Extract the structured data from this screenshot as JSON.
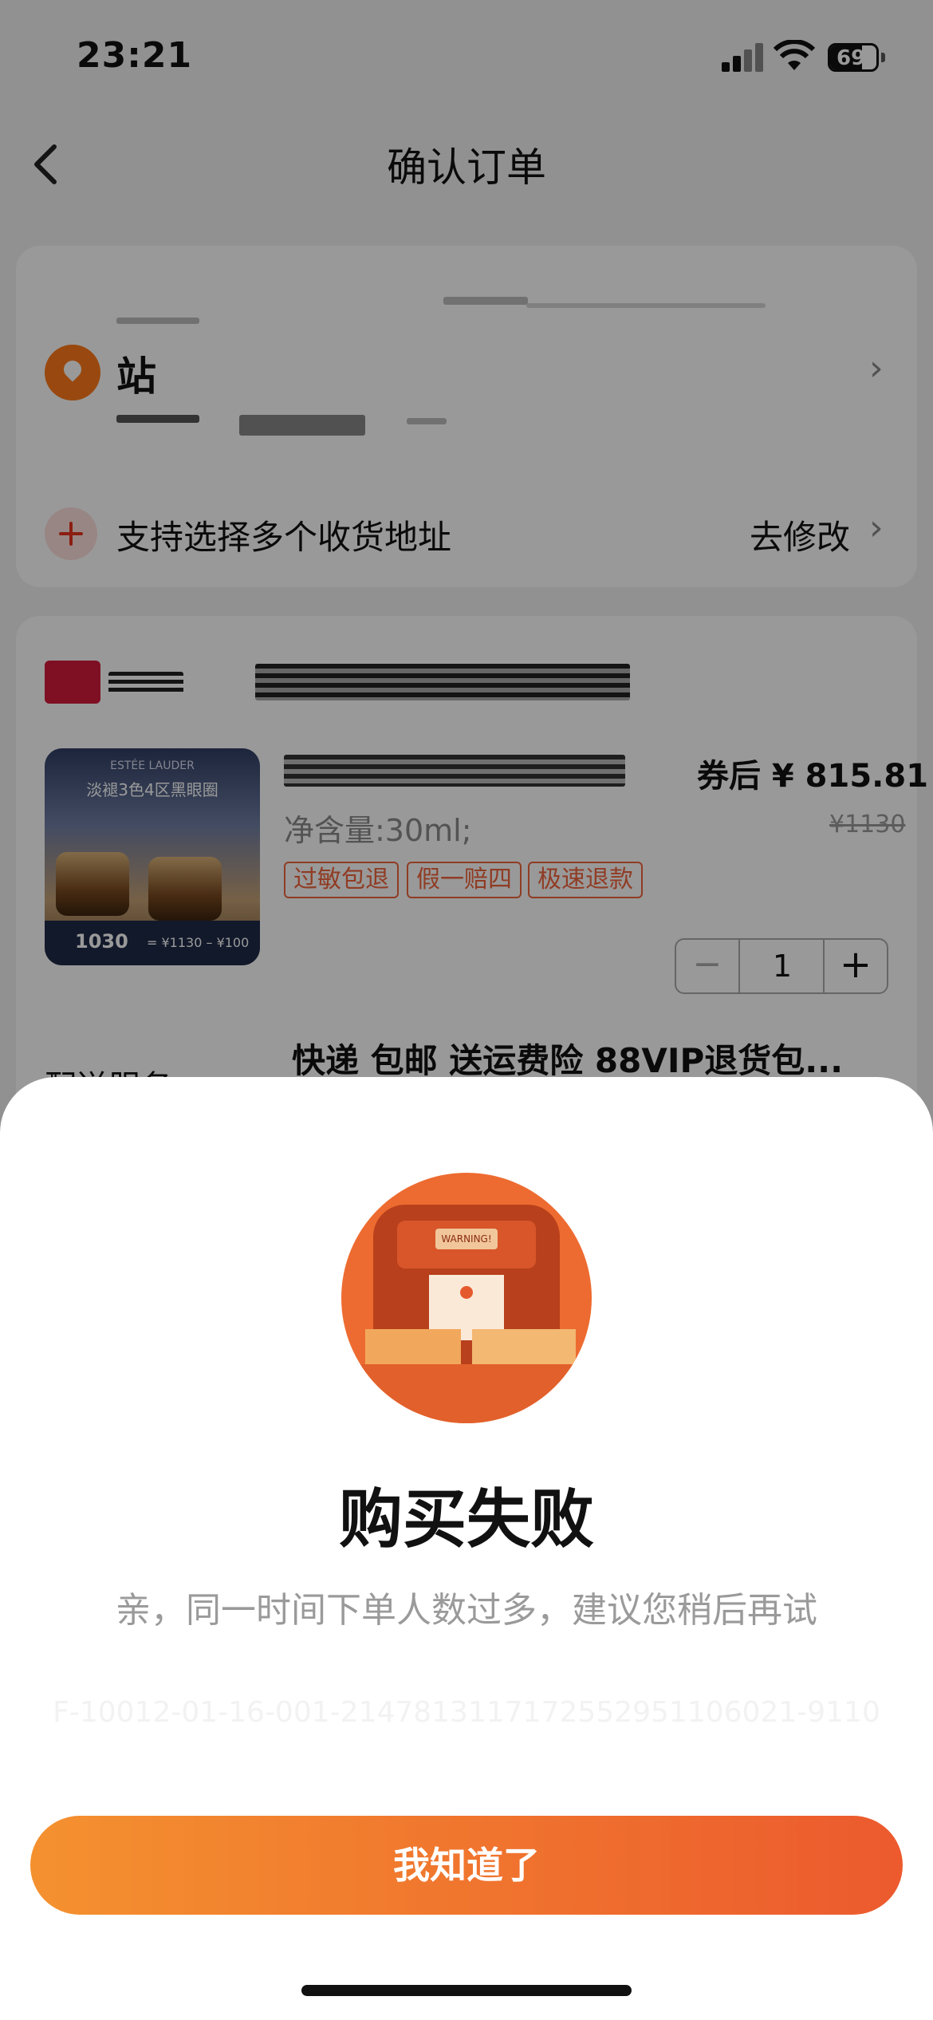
{
  "status_bar": {
    "time": "23:21",
    "battery": "69",
    "battery_level": 0.69
  },
  "nav": {
    "title": "确认订单"
  },
  "address": {
    "station": "站",
    "multi_address": "支持选择多个收货地址",
    "modify": "去修改"
  },
  "product": {
    "image_text": {
      "brand": "ESTÉE LAUDER",
      "headline": "淡褪3色4区黑眼圈",
      "price_label": "1030",
      "formula": "= ¥1130 – ¥100"
    },
    "price": "券后 ¥ 815.81",
    "spec": "净含量:30ml;",
    "old_price": "¥1130",
    "tags": [
      "过敏包退",
      "假一赔四",
      "极速退款"
    ],
    "quantity": "1"
  },
  "delivery": {
    "label": "配送服务",
    "value": "快递 包邮 送运费险 88VIP退货包..."
  },
  "dialog": {
    "illustration_label": "WARNING!",
    "title": "购买失败",
    "message": "亲，同一时间下单人数过多，建议您稍后再试",
    "trace": "F-10012-01-16-001-2147813117172552951106021-9110",
    "button": "我知道了"
  },
  "colors": {
    "accent_start": "#f4912f",
    "accent_end": "#ec5a2e",
    "tag_color": "#f0643c"
  }
}
